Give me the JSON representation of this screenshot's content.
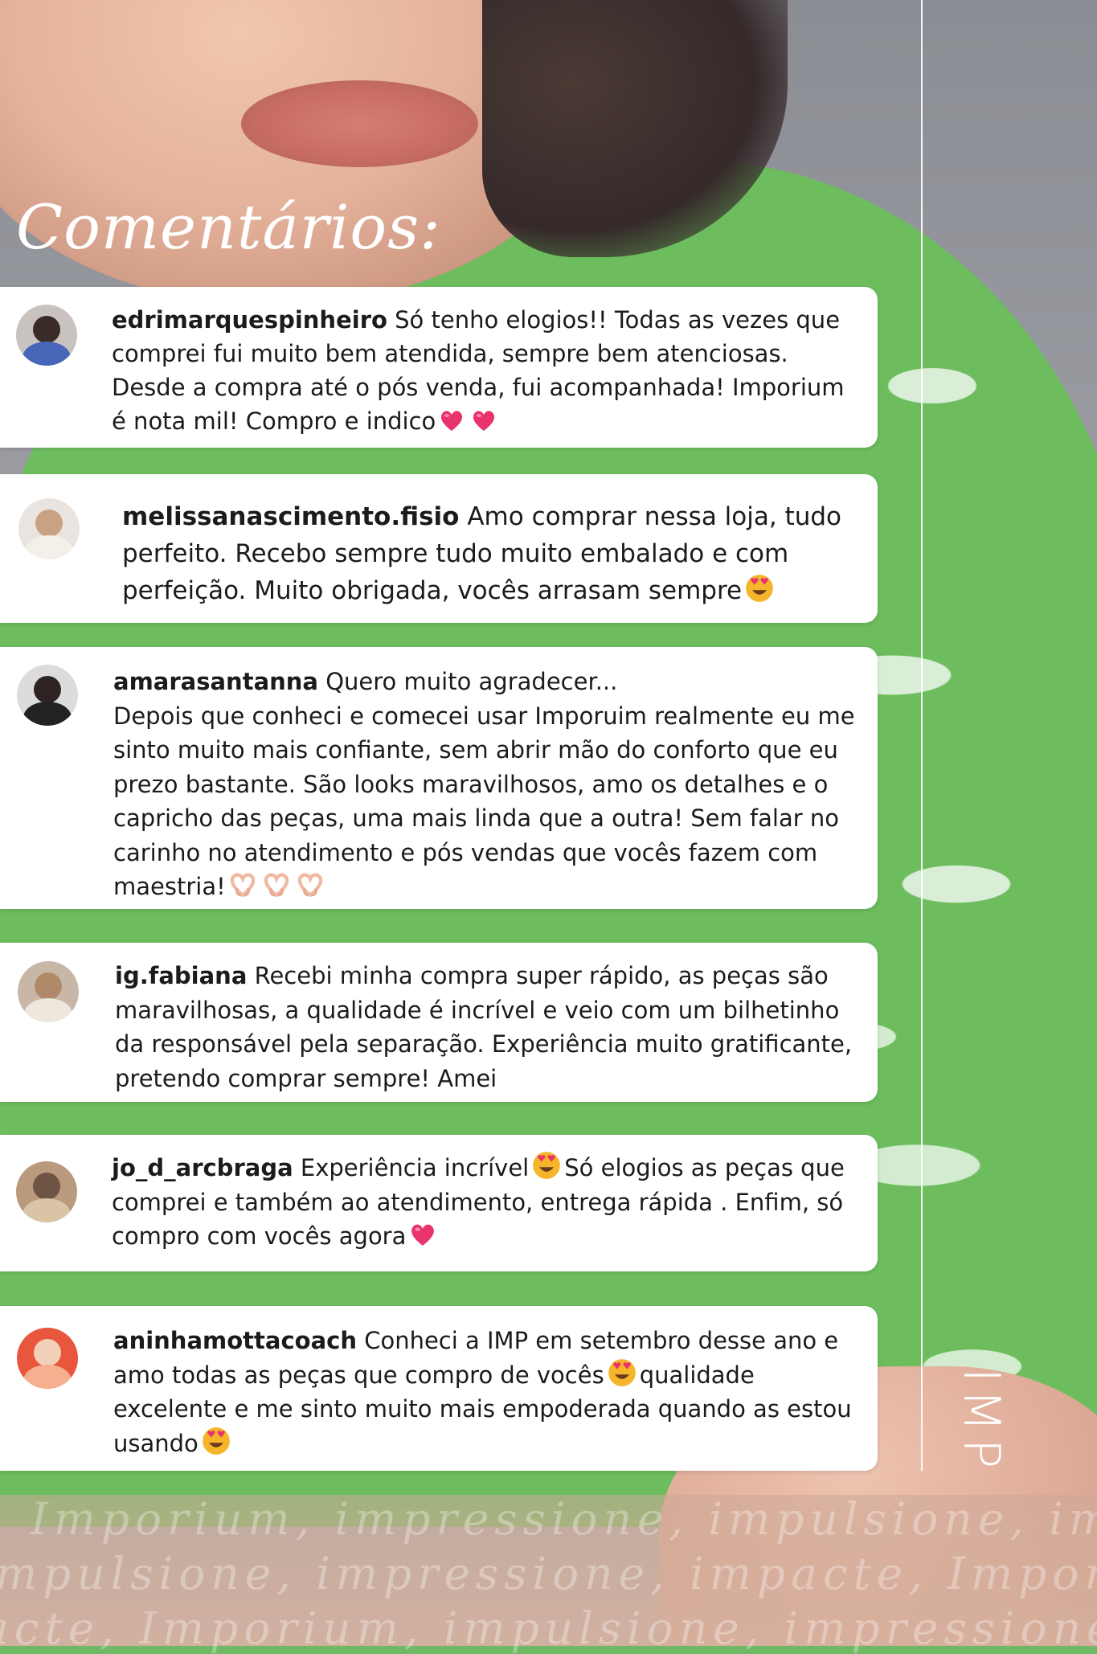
{
  "title": "Comentários:",
  "brand": "IMP",
  "watermark": {
    "line1": "Imporium, impressione, impulsione, impacte",
    "line2": "mpulsione, impressione, impacte, Imporium",
    "line3": "acte, Imporium, impulsione, impressione, i"
  },
  "colors": {
    "card": "#ffffff",
    "shirt_green": "#6dbd5f",
    "text": "#1b1b1b"
  },
  "comments": [
    {
      "username": "edrimarquespinheiro",
      "text": "Só tenho elogios!! Todas as vezes que comprei fui muito bem atendida, sempre bem atenciosas. Desde a compra até o pós venda, fui acompanhada! Imporium é nota mil! Compro e indico",
      "emojis": [
        "heart-emoji",
        "heart-emoji"
      ]
    },
    {
      "username": "melissanascimento.fisio",
      "text": "Amo comprar nessa loja, tudo perfeito. Recebo sempre tudo muito embalado e com perfeição. Muito obrigada, vocês arrasam sempre",
      "emojis": [
        "heart-eyes-emoji"
      ]
    },
    {
      "username": "amarasantanna",
      "text_line1": "Quero muito agradecer...",
      "text": "Depois que conheci e comecei usar Imporuim realmente eu me sinto muito mais confiante, sem abrir mão do conforto que eu prezo bastante. São looks maravilhosos, amo os detalhes e o capricho das peças, uma mais linda que a outra! Sem falar no carinho no atendimento e pós vendas que vocês fazem com maestria!",
      "emojis": [
        "heart-hands-emoji",
        "heart-hands-emoji",
        "heart-hands-emoji"
      ]
    },
    {
      "username": "ig.fabiana",
      "text": "Recebi minha compra super rápido, as peças são maravilhosas, a qualidade é incrível e veio com um bilhetinho da responsável pela separação. Experiência muito gratificante, pretendo comprar sempre! Amei",
      "emojis": []
    },
    {
      "username": "jo_d_arcbraga",
      "text_part1": "Experiência incrível",
      "text_part2": "Só elogios as peças que comprei e também ao atendimento, entrega rápida . Enfim, só compro com vocês agora",
      "emojis": [
        "heart-eyes-emoji",
        "heart-emoji"
      ]
    },
    {
      "username": "aninhamottacoach",
      "text_part1": "Conheci a IMP em setembro desse ano e amo todas as peças que compro de vocês",
      "text_part2": "qualidade excelente e me sinto muito mais empoderada quando as estou usando",
      "emojis": [
        "heart-eyes-emoji",
        "heart-eyes-emoji"
      ]
    }
  ]
}
